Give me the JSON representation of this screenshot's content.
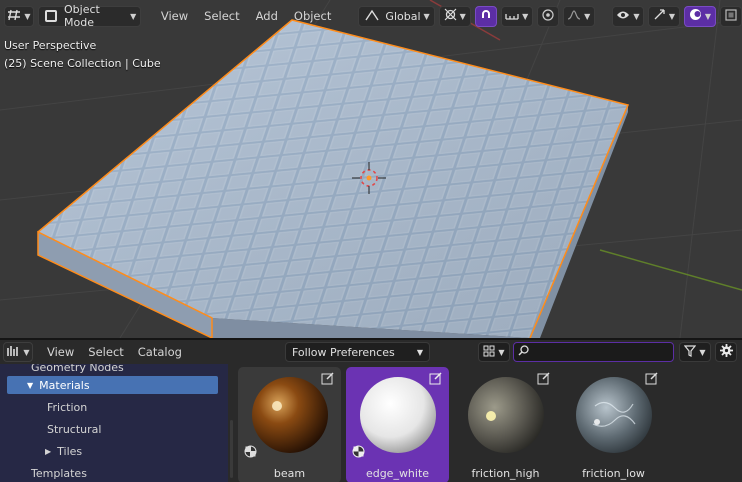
{
  "viewport_header": {
    "mode_label": "Object Mode",
    "menus": [
      "View",
      "Select",
      "Add",
      "Object"
    ],
    "orientation_label": "Global"
  },
  "viewport_overlay": {
    "perspective": "User Perspective",
    "collection_info": "(25) Scene Collection | Cube"
  },
  "asset_browser": {
    "menus": [
      "View",
      "Select",
      "Catalog"
    ],
    "import_method": "Follow Preferences",
    "search_placeholder": "",
    "tree": [
      {
        "label": "Geometry Nodes"
      },
      {
        "label": "Materials",
        "expanded": true,
        "selected": true
      },
      {
        "label": "Friction"
      },
      {
        "label": "Structural"
      },
      {
        "label": "Tiles",
        "collapsed": true
      },
      {
        "label": "Templates"
      }
    ],
    "assets": [
      {
        "name": "beam"
      },
      {
        "name": "edge_white"
      },
      {
        "name": "friction_high"
      },
      {
        "name": "friction_low"
      }
    ]
  },
  "colors": {
    "accent": "#5c2ea5",
    "selection": "#6b33b3",
    "tree_highlight": "#4772b3",
    "object_outline": "#ff8c1a"
  },
  "icons": {
    "editor_type": "editor-type-icon",
    "transform_pivot": "pivot-icon",
    "snap": "snap-magnet-icon",
    "proportional": "proportional-edit-icon",
    "visibility": "eye-icon",
    "gizmo": "gizmo-icon",
    "overlay": "overlay-icon",
    "shading": "shading-icon",
    "asset_editor": "asset-editor-icon",
    "display_mode": "thumbnail-grid-icon",
    "search": "search-icon",
    "filter": "filter-icon",
    "settings": "gear-icon"
  }
}
